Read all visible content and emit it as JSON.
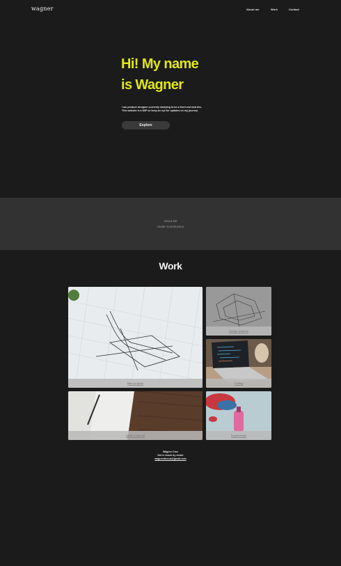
{
  "header": {
    "logo_text": "wagner",
    "nav": {
      "about": "About me",
      "work": "Work",
      "contact": "Contact"
    }
  },
  "hero": {
    "title_line1": "Hi! My name",
    "title_line2": "is Wagner",
    "desc_line1": "I am product designer currently studying to be a front end web dev.",
    "desc_line2": "This website is a WIP so keep an eye for updates on my journey.",
    "explore_label": "Explore"
  },
  "about": {
    "line1": "About Me",
    "line2": "Under Construction"
  },
  "work": {
    "title": "Work",
    "tiles": [
      {
        "label": "Misc projects",
        "icon": "blueprint-image"
      },
      {
        "label": "Design projects",
        "icon": "sketch-image"
      },
      {
        "label": "Coding",
        "icon": "laptop-image"
      },
      {
        "label": "Ideas & journal",
        "icon": "notebook-image"
      },
      {
        "label": "Experiments",
        "icon": "paint-image"
      }
    ]
  },
  "footer": {
    "name": "Wagner Cruz",
    "cta": "Get in touch by email:",
    "email": "wagnerdecruz@gmail.com"
  },
  "colors": {
    "background": "#1b1b1b",
    "accent": "#e2e61a",
    "band": "#323232"
  }
}
